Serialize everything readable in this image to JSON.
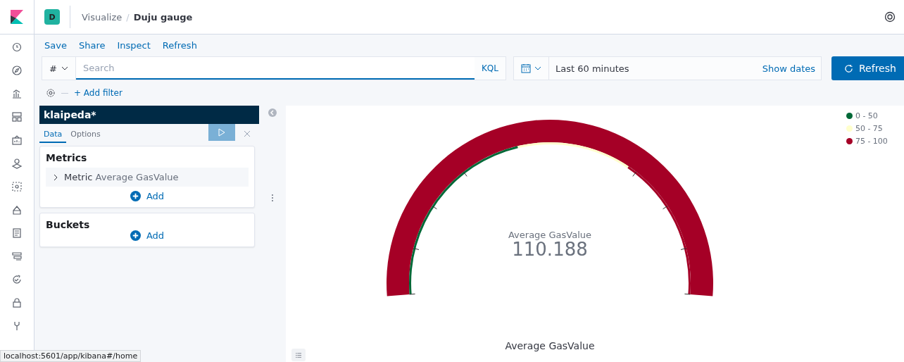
{
  "space_badge": "D",
  "breadcrumb_separator": "/",
  "breadcrumbs": [
    {
      "label": "Visualize",
      "current": false
    },
    {
      "label": "Duju gauge",
      "current": true
    }
  ],
  "top_menu": [
    "Save",
    "Share",
    "Inspect",
    "Refresh"
  ],
  "query": {
    "prefix": "#",
    "placeholder": "Search",
    "language": "KQL"
  },
  "time": {
    "range": "Last 60 minutes",
    "show_dates": "Show dates"
  },
  "refresh_button": "Refresh",
  "add_filter": "+ Add filter",
  "editor": {
    "title": "klaipeda*",
    "tabs": [
      {
        "label": "Data",
        "selected": true
      },
      {
        "label": "Options",
        "selected": false
      }
    ],
    "metrics": {
      "title": "Metrics",
      "items": [
        {
          "prefix": "Metric",
          "label": "Average GasValue"
        }
      ],
      "add": "Add"
    },
    "buckets": {
      "title": "Buckets",
      "add": "Add"
    }
  },
  "gauge": {
    "label": "Average GasValue",
    "value": "110.188",
    "title": "Average GasValue",
    "legend": [
      {
        "label": "0 - 50",
        "color": "#006837"
      },
      {
        "label": "50 - 75",
        "color": "#ffffcc"
      },
      {
        "label": "75 - 100",
        "color": "#a50026"
      }
    ]
  },
  "status_url": "localhost:5601/app/kibana#/home"
}
